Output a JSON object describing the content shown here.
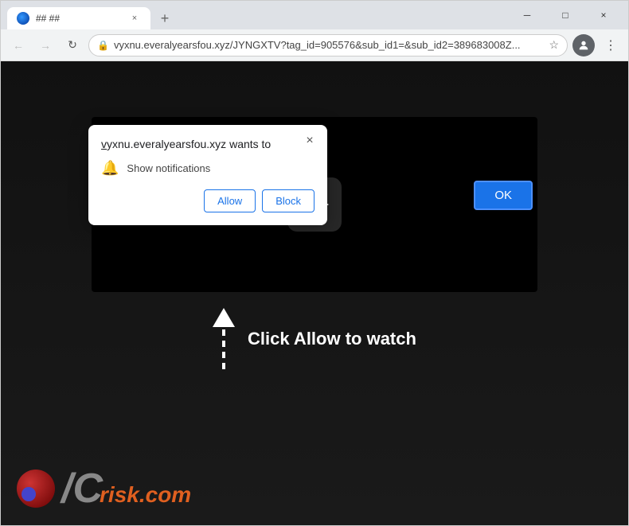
{
  "browser": {
    "tab": {
      "favicon_label": "site-favicon",
      "title": "## ##",
      "close_label": "×",
      "new_tab_label": "+"
    },
    "window_controls": {
      "minimize": "─",
      "maximize": "□",
      "close": "×"
    },
    "address_bar": {
      "back_label": "←",
      "forward_label": "→",
      "refresh_label": "↻",
      "url": "vyxnu.everalyearsfou.xyz/JYNGXTV?tag_id=905576&sub_id1=&sub_id2=389683008Z...",
      "star_label": "☆",
      "profile_label": "👤",
      "menu_label": "⋮"
    }
  },
  "dialog": {
    "domain": "vyxnu.everalyearsfou.xyz",
    "wants_to": " wants to",
    "permission_text": "Show notifications",
    "close_label": "×",
    "allow_button": "Allow",
    "block_button": "Block"
  },
  "ok_button": "OK",
  "page": {
    "click_allow_text": "Click Allow to watch"
  },
  "pcrisk": {
    "pc_letters": "PC",
    "risk_text": "risk.com"
  }
}
